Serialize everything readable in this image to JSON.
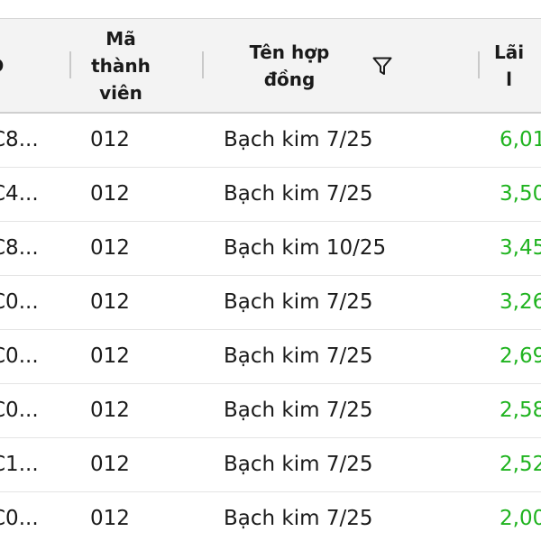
{
  "header": {
    "id_label": "D",
    "member_label": "Mã\nthành\nviên",
    "contract_label": "Tên hợp đồng",
    "profit_label": "Lãi\nl",
    "filter_icon": "filter-icon"
  },
  "rows": [
    {
      "id": "C8...",
      "member": "012",
      "contract": "Bạch kim 7/25",
      "profit": "6,01"
    },
    {
      "id": "C4...",
      "member": "012",
      "contract": "Bạch kim 7/25",
      "profit": "3,50"
    },
    {
      "id": "C8...",
      "member": "012",
      "contract": "Bạch kim 10/25",
      "profit": "3,45"
    },
    {
      "id": "C0...",
      "member": "012",
      "contract": "Bạch kim 7/25",
      "profit": "3,26"
    },
    {
      "id": "C0...",
      "member": "012",
      "contract": "Bạch kim 7/25",
      "profit": "2,69"
    },
    {
      "id": "C0...",
      "member": "012",
      "contract": "Bạch kim 7/25",
      "profit": "2,58"
    },
    {
      "id": "C1...",
      "member": "012",
      "contract": "Bạch kim 7/25",
      "profit": "2,52"
    },
    {
      "id": "C0...",
      "member": "012",
      "contract": "Bạch kim 7/25",
      "profit": "2,00"
    }
  ],
  "colors": {
    "header_bg": "#f3f3f3",
    "profit_positive": "#1fb31f",
    "text": "#1a1a1a"
  }
}
